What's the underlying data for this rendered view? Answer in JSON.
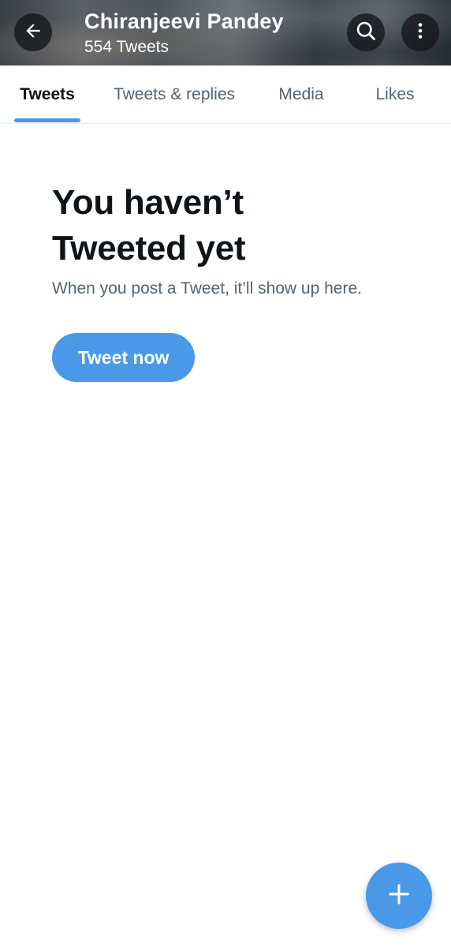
{
  "header": {
    "title": "Chiranjeevi Pandey",
    "subtitle": "554 Tweets",
    "icons": {
      "back": "arrow-left-icon",
      "search": "search-icon",
      "more": "more-vertical-icon"
    }
  },
  "tabs": [
    {
      "label": "Tweets",
      "active": true
    },
    {
      "label": "Tweets & replies",
      "active": false
    },
    {
      "label": "Media",
      "active": false
    },
    {
      "label": "Likes",
      "active": false
    }
  ],
  "empty_state": {
    "title_line1": "You haven’t",
    "title_line2": "Tweeted yet",
    "message": "When you post a Tweet, it’ll show up here.",
    "button_label": "Tweet now"
  },
  "fab": {
    "icon": "plus-icon"
  },
  "colors": {
    "accent": "#4a99e9",
    "text_primary": "#0f1419",
    "text_secondary": "#536471",
    "divider": "#e6ecf0"
  }
}
